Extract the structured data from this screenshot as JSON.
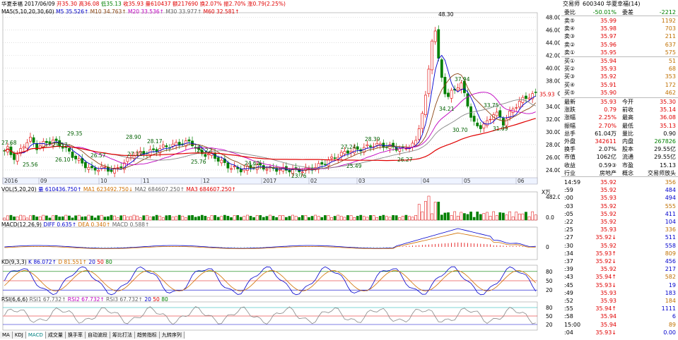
{
  "header": {
    "stock_name": "华夏幸福",
    "date": "2017/06/09",
    "open": "开35.30",
    "high": "高36.08",
    "low": "低35.13",
    "close": "收35.93",
    "volume": "量610437",
    "amount": "额217690",
    "turnover": "换2.07%",
    "amplitude": "振2.70%",
    "change": "涨0.79(2.25%)"
  },
  "ma_legend": {
    "label": "MA5(5,10,20,30,60)",
    "ma5": "M5 35.526↑",
    "ma10": "M10 34.763↑",
    "ma20": "M20 33.536↑",
    "ma30": "M30 33.977↑",
    "ma60": "M60 32.581↑"
  },
  "price_annotations": [
    "48.30",
    "27.68",
    "25.56",
    "29.35",
    "26.10",
    "27.57",
    "26.57",
    "28.90",
    "27.12",
    "28.17",
    "26.22",
    "25.76",
    "24.62",
    "23.76",
    "27.24",
    "25.49",
    "28.39",
    "26.27",
    "34.21",
    "37.94",
    "30.70",
    "31.09",
    "33.75"
  ],
  "price_axis": [
    "48.00",
    "46.00",
    "44.00",
    "42.00",
    "40.00",
    "38.00",
    "36.00",
    "34.00",
    "32.00",
    "30.00",
    "28.00",
    "26.00",
    "24.00"
  ],
  "last_price_label": "35.93",
  "months": [
    "2016",
    "09",
    "10",
    "11",
    "12",
    "2017",
    "02",
    "03",
    "04",
    "05",
    "06"
  ],
  "vol": {
    "label": "VOL(5,20,20)",
    "main": "量 610436.750↑",
    "ma1": "MA1 623492.750↓",
    "ma2": "MA2 684607.250↑",
    "ma3": "MA3 684607.250↑",
    "unit": "X万",
    "axis": [
      "482.0",
      "0.0"
    ]
  },
  "macd": {
    "label": "MACD(12,26,9)",
    "diff": "DIFF 0.635↑",
    "dea": "DEA 0.340↑",
    "macd": "MACD 0.588↑",
    "axis": [
      "0"
    ]
  },
  "kdj": {
    "label": "KD(9,3,3)",
    "k": "K 86.072↑",
    "d": "D 81.551↑",
    "l1": "20",
    "l2": "50",
    "l3": "80",
    "axis": [
      "80",
      "50",
      "20"
    ]
  },
  "rsi": {
    "label": "RSI(6,6,6)",
    "r1": "RSI1 67.732↑",
    "r2": "RSI2 67.732↑",
    "r3": "RSI3 67.732↑",
    "l1": "20",
    "l2": "50",
    "l3": "80",
    "axis": [
      "80",
      "50",
      "20"
    ]
  },
  "tabs": [
    "MA",
    "KDJ",
    "MACD",
    "成交量",
    "换手率",
    "自动波段",
    "筹比打法",
    "趋势指标",
    "九转序列"
  ],
  "side": {
    "title": "交易师",
    "code": "600340 华夏幸福(14)",
    "weibi_label": "委比",
    "weibi": "-50.01%",
    "weicha_label": "委差",
    "weicha": "-2212",
    "sells": [
      {
        "label": "卖⑤",
        "price": "35.99",
        "vol": "1192"
      },
      {
        "label": "卖④",
        "price": "35.98",
        "vol": "703"
      },
      {
        "label": "卖③",
        "price": "35.97",
        "vol": "211"
      },
      {
        "label": "卖②",
        "price": "35.96",
        "vol": "637"
      },
      {
        "label": "卖①",
        "price": "35.95",
        "vol": "575"
      }
    ],
    "buys": [
      {
        "label": "买①",
        "price": "35.94",
        "vol": "51"
      },
      {
        "label": "买②",
        "price": "35.93",
        "vol": "68"
      },
      {
        "label": "买③",
        "price": "35.92",
        "vol": "353"
      },
      {
        "label": "买④",
        "price": "35.91",
        "vol": "172"
      },
      {
        "label": "买⑤",
        "price": "35.90",
        "vol": "462"
      }
    ],
    "quote": [
      [
        "最新",
        "35.93",
        "今开",
        "35.30"
      ],
      [
        "涨跌",
        "0.79",
        "前收",
        "35.14"
      ],
      [
        "涨幅",
        "2.25%",
        "最高",
        "36.08"
      ],
      [
        "振幅",
        "2.70%",
        "最低",
        "35.13"
      ],
      [
        "总手",
        "61.04万",
        "量比",
        "0.90"
      ],
      [
        "外盘",
        "342611",
        "内盘",
        "267826"
      ],
      [
        "换手",
        "2.07%",
        "股本",
        "29.55亿"
      ],
      [
        "市值",
        "1062亿",
        "流通",
        "29.55亿"
      ],
      [
        "收益",
        "0.59③",
        "市盈",
        "15.13"
      ],
      [
        "行业",
        "房地产",
        "概念",
        "交易师放头"
      ]
    ],
    "ticks": [
      [
        "14:59",
        "35.92",
        "356"
      ],
      [
        ":59",
        "35.92",
        "484"
      ],
      [
        ":00",
        "35.93",
        "494"
      ],
      [
        ":03",
        "35.92",
        "555"
      ],
      [
        ":05",
        "35.92",
        "411"
      ],
      [
        ":22",
        "35.92",
        "104"
      ],
      [
        ":25",
        "35.93",
        "336"
      ],
      [
        ":27",
        "35.92↓",
        "511"
      ],
      [
        ":30",
        "35.92",
        "558"
      ],
      [
        ":34",
        "35.93↑",
        "809"
      ],
      [
        ":37",
        "35.92↓",
        "456"
      ],
      [
        ":39",
        "35.92",
        "217"
      ],
      [
        ":43",
        "35.94↑",
        "582"
      ],
      [
        ":45",
        "35.93↓",
        "19"
      ],
      [
        ":49",
        "35.93",
        "183"
      ],
      [
        ":52",
        "35.93",
        "184"
      ],
      [
        ":55",
        "35.94↑",
        "1111"
      ],
      [
        ":58",
        "35.94",
        "6"
      ],
      [
        "15:00",
        "35.94",
        "89"
      ],
      [
        ":04",
        "35.93↓",
        "0.00"
      ]
    ]
  }
}
